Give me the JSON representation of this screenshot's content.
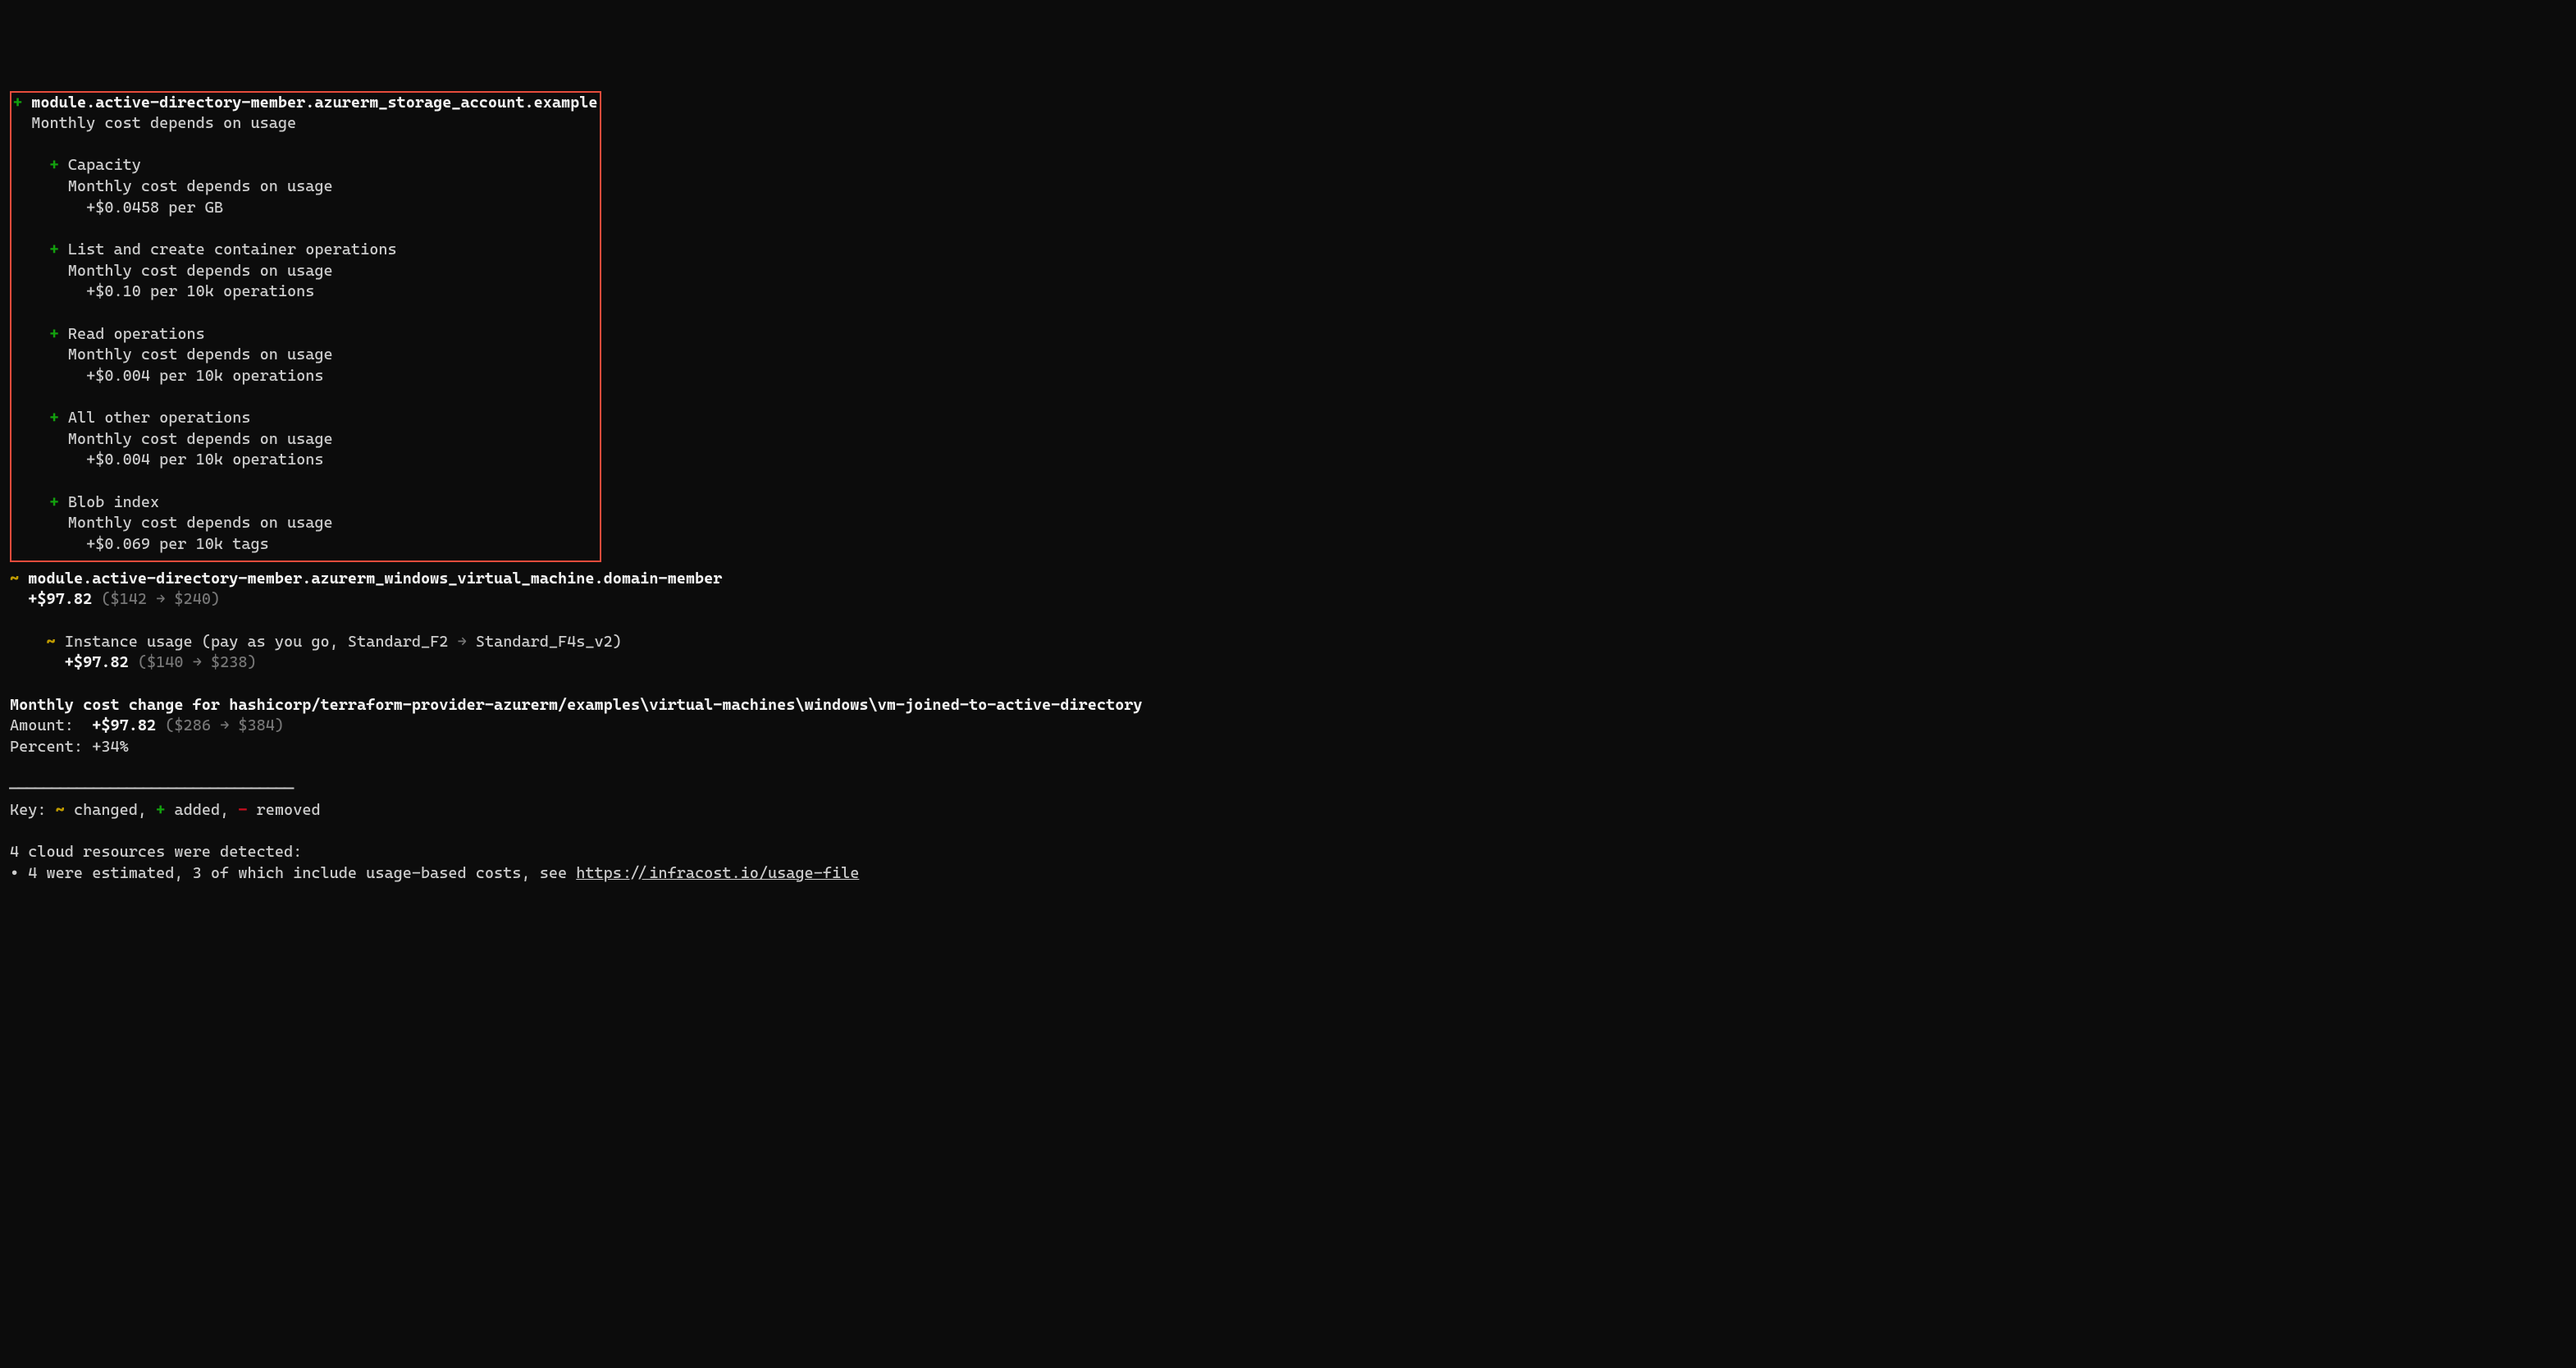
{
  "storage": {
    "header_prefix": "+",
    "header_name": "module.active-directory-member.azurerm_storage_account.example",
    "header_sub": "Monthly cost depends on usage",
    "items": [
      {
        "prefix": "+",
        "name": "Capacity",
        "sub": "Monthly cost depends on usage",
        "rate": "+$0.0458 per GB"
      },
      {
        "prefix": "+",
        "name": "List and create container operations",
        "sub": "Monthly cost depends on usage",
        "rate": "+$0.10 per 10k operations"
      },
      {
        "prefix": "+",
        "name": "Read operations",
        "sub": "Monthly cost depends on usage",
        "rate": "+$0.004 per 10k operations"
      },
      {
        "prefix": "+",
        "name": "All other operations",
        "sub": "Monthly cost depends on usage",
        "rate": "+$0.004 per 10k operations"
      },
      {
        "prefix": "+",
        "name": "Blob index",
        "sub": "Monthly cost depends on usage",
        "rate": "+$0.069 per 10k tags"
      }
    ]
  },
  "vm": {
    "header_prefix": "~",
    "header_name": "module.active-directory-member.azurerm_windows_virtual_machine.domain-member",
    "header_cost": "+$97.82",
    "header_from": "$142",
    "header_to": "$240",
    "sub_prefix": "~",
    "sub_name": "Instance usage (pay as you go, Standard_F2",
    "sub_arrow_to": "Standard_F4s_v2)",
    "sub_cost": "+$97.82",
    "sub_from": "$140",
    "sub_to": "$238"
  },
  "summary": {
    "change_label": "Monthly cost change for",
    "change_path": "hashicorp/terraform-provider-azurerm/examples\\virtual-machines\\windows\\vm-joined-to-active-directory",
    "amount_label": "Amount:",
    "amount_value": "+$97.82",
    "amount_from": "$286",
    "amount_to": "$384",
    "percent_label": "Percent:",
    "percent_value": "+34%"
  },
  "divider": "──────────────────────────────────",
  "key": {
    "label": "Key:",
    "changed_symbol": "~",
    "changed_text": "changed,",
    "added_symbol": "+",
    "added_text": "added,",
    "removed_symbol": "-",
    "removed_text": "removed"
  },
  "footer": {
    "line1": "4 cloud resources were detected:",
    "line2_prefix": "∙ 4 were estimated, 3 of which include usage-based costs, see ",
    "line2_link": "https://infracost.io/usage-file"
  }
}
